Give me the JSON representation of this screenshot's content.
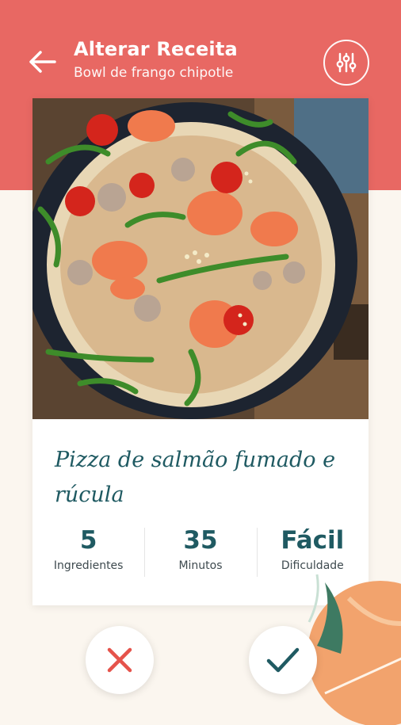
{
  "header": {
    "title": "Alterar Receita",
    "subtitle": "Bowl de frango chipotle",
    "back_icon": "arrow-left-icon",
    "filter_icon": "sliders-icon"
  },
  "recipe": {
    "name": "Pizza de salmão fumado e rúcula",
    "image_description": "salmon-arugula-pizza-photo",
    "stats": [
      {
        "value": "5",
        "label": "Ingredientes"
      },
      {
        "value": "35",
        "label": "Minutos"
      },
      {
        "value": "Fácil",
        "label": "Dificuldade"
      }
    ]
  },
  "actions": {
    "reject_icon": "close-icon",
    "accept_icon": "check-icon"
  },
  "colors": {
    "header": "#e86863",
    "primary_text": "#1f5a62",
    "reject": "#e5534b",
    "background": "#fbf6ef"
  }
}
